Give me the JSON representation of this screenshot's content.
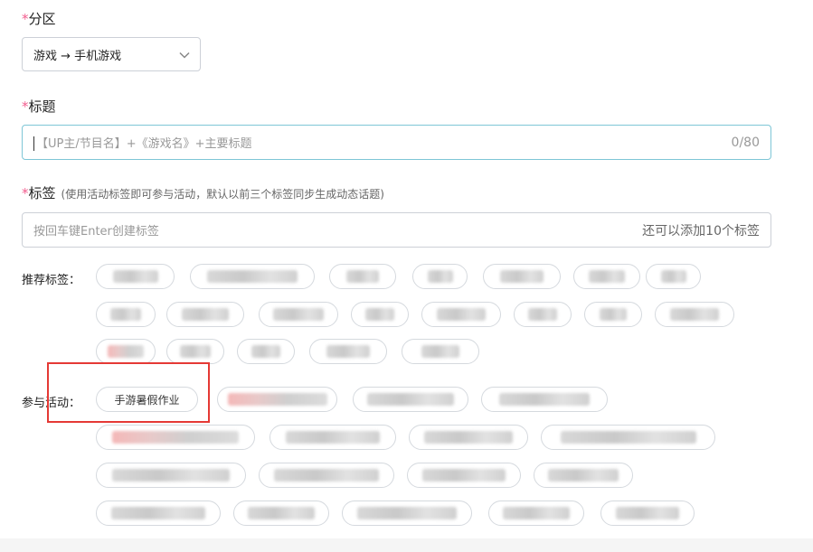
{
  "partition": {
    "required_mark": "*",
    "label": "分区",
    "selected": "游戏 → 手机游戏"
  },
  "title_field": {
    "required_mark": "*",
    "label": "标题",
    "placeholder": "【UP主/节目名】+《游戏名》+主要标题",
    "counter": "0/80"
  },
  "tags_field": {
    "required_mark": "*",
    "label": "标签",
    "hint": "(使用活动标签即可参与活动，默认以前三个标签同步生成动态话题)",
    "placeholder": "按回车键Enter创建标签",
    "remaining": "还可以添加10个标签"
  },
  "recommended": {
    "label": "推荐标签："
  },
  "activities": {
    "label": "参与活动：",
    "first_chip": "手游暑假作业"
  },
  "icons": {
    "dropdown": "chevron-down-icon"
  },
  "colors": {
    "required": "#f25d8e",
    "focus_border": "#7ec6d6",
    "highlight_box": "#e53935"
  }
}
